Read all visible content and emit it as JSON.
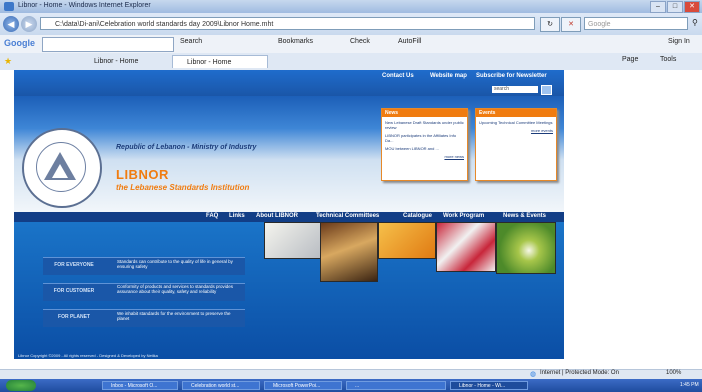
{
  "window": {
    "title": "Libnor - Home - Windows Internet Explorer",
    "address": "C:\\data\\Di-ani\\Celebration world standards day 2009\\Libnor Home.mht",
    "search_placeholder": "Google"
  },
  "google_toolbar": {
    "logo": "Google",
    "items": [
      "Search",
      "Bookmarks",
      "Check",
      "AutoFill"
    ]
  },
  "tabs": [
    {
      "label": "Libnor - Home"
    },
    {
      "label": "Libnor - Home"
    }
  ],
  "commands": [
    "Page",
    "Tools"
  ],
  "sign_in": "Sign In",
  "site": {
    "top_links": [
      "Contact Us",
      "Website map",
      "Subscribe for Newsletter"
    ],
    "search_value": "search",
    "republic": "Republic of Lebanon - Ministry of Industry",
    "name": "LIBNOR",
    "subtitle": "the Lebanese Standards Institution",
    "news": {
      "title": "News",
      "items": [
        "New Lebanese Draft Standards under public review",
        "LIBNOR participates in the Affiliates Info Da...",
        "MOU between LIBNOR and ..."
      ],
      "more": "more news"
    },
    "events": {
      "title": "Events",
      "items": [
        "Upcoming Technical Committee Meetings"
      ],
      "more": "more events"
    },
    "nav": [
      "FAQ",
      "Links",
      "About LIBNOR",
      "Technical Committees",
      "Catalogue",
      "Work Program",
      "News & Events"
    ],
    "pillars": [
      {
        "label": "FOR EVERYONE",
        "text": "Standards can contribute to the quality of life in general by ensuring safety"
      },
      {
        "label": "FOR CUSTOMER",
        "text": "Conformity of products and services to standards provides assurance about their quality, safety and reliability"
      },
      {
        "label": "FOR PLANET",
        "text": "We inhabit standards for the environment to preserve the planet"
      }
    ],
    "copyright": "Libnor Copyright ©2009 - All rights reserved - Designed & Developed by Netika"
  },
  "status": {
    "zone": "Internet | Protected Mode: On",
    "zoom": "100%"
  },
  "taskbar": {
    "items": [
      "Inbox - Microsoft O...",
      "Celebration world st...",
      "Microsoft PowerPoi...",
      "...",
      "Libnor - Home - Wi..."
    ],
    "time": "1:45 PM"
  },
  "colors": {
    "site_blue": "#1a56a8",
    "nav_blue": "#123e86",
    "brand_orange": "#f07c10"
  }
}
